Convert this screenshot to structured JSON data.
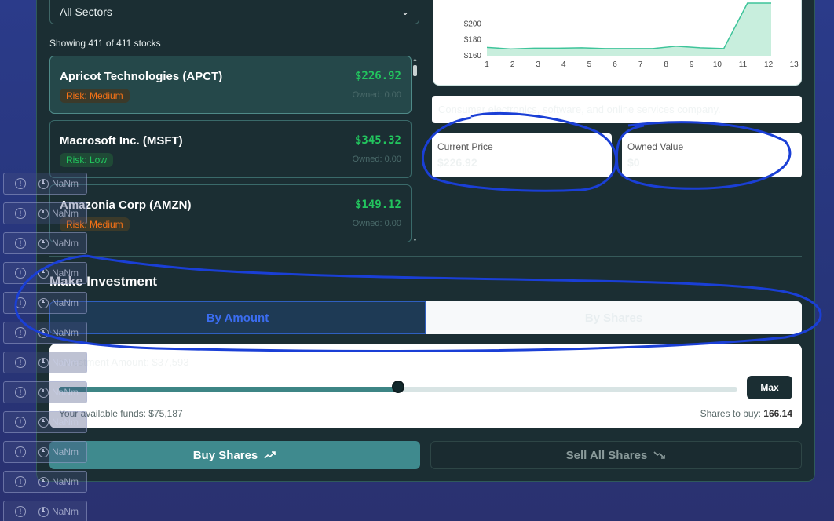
{
  "sector_filter": {
    "selected": "All Sectors"
  },
  "showing_text": "Showing 411 of 411 stocks",
  "stocks": [
    {
      "name": "Apricot Technologies (APCT)",
      "price": "$226.92",
      "risk": "Risk: Medium",
      "owned": "Owned: 0.00",
      "risk_level": "medium",
      "selected": true
    },
    {
      "name": "Macrosoft Inc. (MSFT)",
      "price": "$345.32",
      "risk": "Risk: Low",
      "owned": "Owned: 0.00",
      "risk_level": "low",
      "selected": false
    },
    {
      "name": "Amazonia Corp (AMZN)",
      "price": "$149.12",
      "risk": "Risk: Medium",
      "owned": "Owned: 0.00",
      "risk_level": "medium",
      "selected": false
    }
  ],
  "chart_data": {
    "type": "area",
    "x": [
      1,
      2,
      3,
      4,
      5,
      6,
      7,
      8,
      9,
      10,
      11,
      12,
      13
    ],
    "series": [
      {
        "values": [
          170.5,
          168.5,
          169.5,
          169.5,
          170,
          169,
          169,
          169,
          172,
          170,
          169,
          226,
          226
        ]
      }
    ],
    "y_ticks": [
      "$200",
      "$180",
      "$160"
    ],
    "ylim": [
      160,
      225
    ],
    "color": "#3ec49a"
  },
  "description": "Consumer electronics, software, and online services company.",
  "metrics": {
    "current_price_label": "Current Price",
    "current_price_value": "$226.92",
    "owned_value_label": "Owned Value",
    "owned_value_value": "$0"
  },
  "investment": {
    "title": "Make Investment",
    "tab_amount": "By Amount",
    "tab_shares": "By Shares",
    "amount_label": "Investment Amount: $37,593",
    "slider_fraction": 0.5,
    "max_label": "Max",
    "funds_text": "Your available funds: $75,187",
    "shares_label": "Shares to buy:",
    "shares_value": "166.14"
  },
  "actions": {
    "buy_label": "Buy Shares",
    "sell_label": "Sell All Shares"
  },
  "debug_overlay": {
    "label": "NaNm"
  },
  "colors": {
    "accent": "#3f8a8e",
    "positive": "#22c55e",
    "annotation": "#1a3fd6"
  }
}
